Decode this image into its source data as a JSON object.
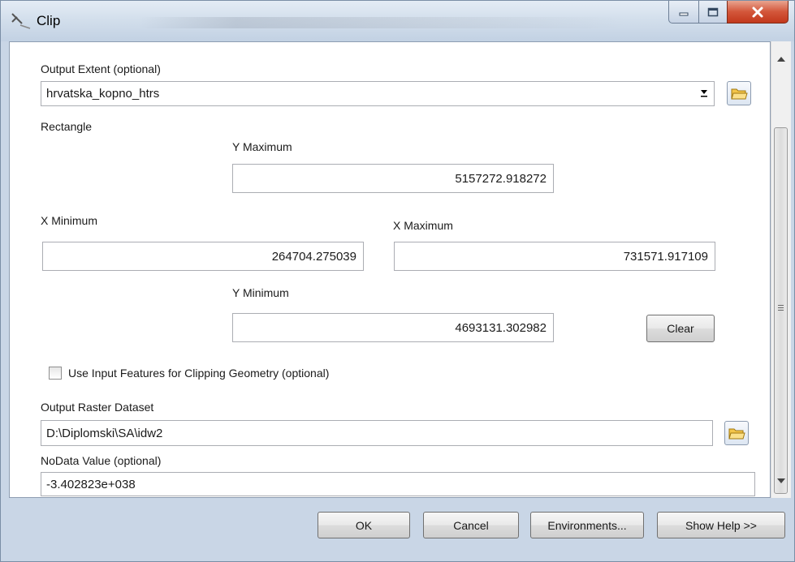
{
  "window": {
    "title": "Clip",
    "controls": {
      "minimize": "minimize",
      "maximize": "maximize",
      "close": "close"
    }
  },
  "output_extent": {
    "label": "Output Extent (optional)",
    "selected": "hrvatska_kopno_htrs"
  },
  "rectangle": {
    "label": "Rectangle",
    "y_max_label": "Y Maximum",
    "y_max": "5157272.918272",
    "x_min_label": "X Minimum",
    "x_min": "264704.275039",
    "x_max_label": "X Maximum",
    "x_max": "731571.917109",
    "y_min_label": "Y Minimum",
    "y_min": "4693131.302982",
    "clear_label": "Clear"
  },
  "use_input_features": {
    "label": "Use Input Features for Clipping Geometry (optional)",
    "checked": false
  },
  "output_raster": {
    "label": "Output Raster Dataset",
    "value": "D:\\Diplomski\\SA\\idw2"
  },
  "nodata": {
    "label": "NoData Value (optional)",
    "value": "-3.402823e+038"
  },
  "buttons": {
    "ok": "OK",
    "cancel": "Cancel",
    "environments": "Environments...",
    "show_help": "Show Help >>"
  }
}
